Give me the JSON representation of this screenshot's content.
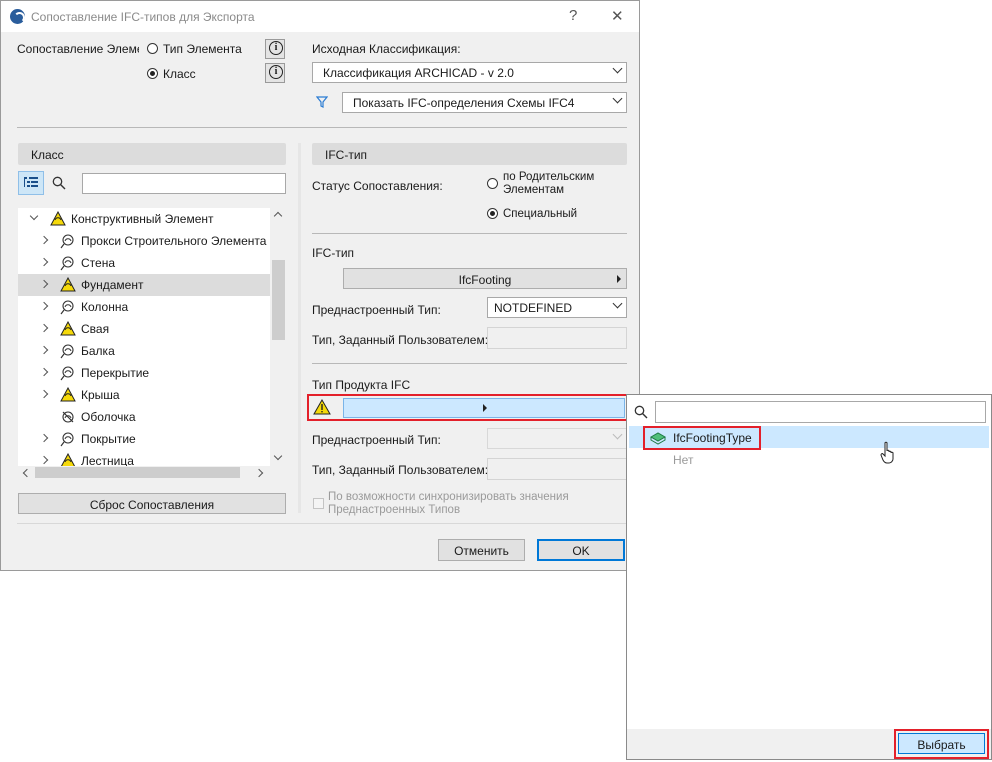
{
  "dialog": {
    "title": "Сопоставление IFC-типов для Экспорта",
    "help_label": "?",
    "close_label": "✕"
  },
  "mapping": {
    "label": "Сопоставление Элеме",
    "option_element_type": "Тип Элемента",
    "option_class": "Класс",
    "selected": "Класс"
  },
  "source": {
    "label": "Исходная Классификация:",
    "classification_value": "Классификация ARCHICAD - v 2.0",
    "schema_value": "Показать IFC-определения Схемы IFC4"
  },
  "class_panel": {
    "header": "Класс",
    "search_value": "",
    "items": [
      {
        "label": "Конструктивный Элемент",
        "level": 0,
        "expanded": true,
        "icon": "warning-icon"
      },
      {
        "label": "Прокси Строительного Элемента",
        "level": 1,
        "icon": "ifc-icon"
      },
      {
        "label": "Стена",
        "level": 1,
        "icon": "ifc-icon"
      },
      {
        "label": "Фундамент",
        "level": 1,
        "icon": "warning-icon",
        "selected": true
      },
      {
        "label": "Колонна",
        "level": 1,
        "icon": "ifc-icon"
      },
      {
        "label": "Свая",
        "level": 1,
        "icon": "warning-icon"
      },
      {
        "label": "Балка",
        "level": 1,
        "icon": "ifc-icon"
      },
      {
        "label": "Перекрытие",
        "level": 1,
        "icon": "ifc-icon"
      },
      {
        "label": "Крыша",
        "level": 1,
        "icon": "warning-icon"
      },
      {
        "label": "Оболочка",
        "level": 1,
        "icon": "ifc-crossed-icon"
      },
      {
        "label": "Покрытие",
        "level": 1,
        "icon": "ifc-icon"
      },
      {
        "label": "Лестница",
        "level": 1,
        "icon": "warning-icon"
      }
    ],
    "reset_label": "Сброс Сопоставления"
  },
  "ifc_panel": {
    "header": "IFC-тип",
    "status_label": "Статус Сопоставления:",
    "status_option_parent": "по Родительским Элементам",
    "status_option_special": "Специальный",
    "status_selected": "Специальный",
    "ifc_type_label": "IFC-тип",
    "ifc_type_value": "IfcFooting",
    "predefined_label": "Преднастроенный Тип:",
    "predefined_value": "NOTDEFINED",
    "user_defined_label": "Тип, Заданный Пользователем:",
    "user_defined_value": "",
    "product_type_label": "Тип Продукта IFC",
    "product_type_value": "",
    "predefined2_label": "Преднастроенный Тип:",
    "predefined2_value": "",
    "user_defined2_label": "Тип, Заданный Пользователем:",
    "user_defined2_value": "",
    "sync_label": "По возможности синхронизировать значения Преднастроенных Типов",
    "sync_checked": false
  },
  "footer": {
    "cancel_label": "Отменить",
    "ok_label": "OK"
  },
  "popup": {
    "search_value": "",
    "items": [
      {
        "label": "IfcFootingType",
        "highlighted": true,
        "icon": "ifc-type-icon"
      },
      {
        "label": "Нет",
        "highlighted": false
      }
    ],
    "select_label": "Выбрать"
  },
  "colors": {
    "highlight_red": "#e3202a",
    "selection_blue": "#cce8ff",
    "primary_blue": "#0078d7",
    "warning_yellow": "#f5d90a"
  }
}
